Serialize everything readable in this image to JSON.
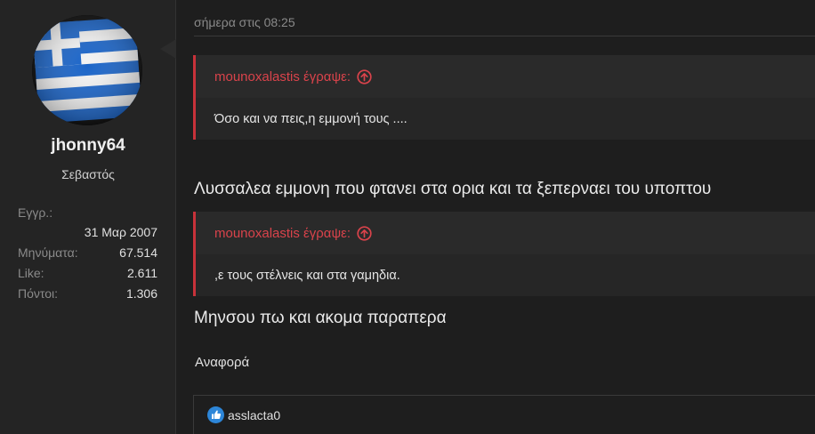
{
  "user": {
    "username": "jhonny64",
    "title": "Σεβαστός",
    "stats": {
      "joined_label": "Εγγρ.:",
      "joined_value": "31 Μαρ 2007",
      "messages_label": "Μηνύματα:",
      "messages_value": "67.514",
      "likes_label": "Like:",
      "likes_value": "2.611",
      "points_label": "Πόντοι:",
      "points_value": "1.306"
    },
    "avatar_icon": "greek-flag-avatar"
  },
  "post": {
    "timestamp": "σήμερα στις 08:25",
    "quote1": {
      "author": "mounoxalastis έγραψε:",
      "text": "Όσο και να πεις,η εμμονή τους ...."
    },
    "reply1": "Λυσσαλεα εμμονη που φτανει στα ορια και τα ξεπερναει του υποπτου",
    "quote2": {
      "author": "mounoxalastis έγραψε:",
      "text": ",ε τους στέλνεις και στα γαμηδια."
    },
    "reply2": "Μηνσου πω και ακομα παραπερα",
    "report_label": "Αναφορά",
    "reaction_user": "asslacta0"
  },
  "colors": {
    "background": "#1e1e1e",
    "sidebar": "#242424",
    "quote_accent": "#c8323a",
    "like_blue": "#2d86d8"
  }
}
